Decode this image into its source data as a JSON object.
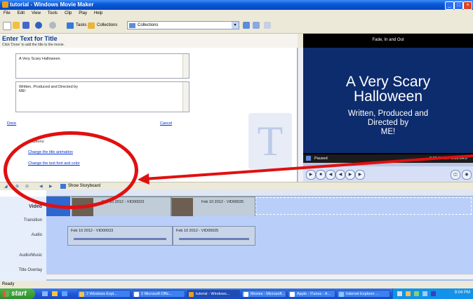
{
  "window": {
    "title": "tutorial - Windows Movie Maker",
    "controls": [
      "_",
      "□",
      "×"
    ]
  },
  "menu": [
    "File",
    "Edit",
    "View",
    "Tools",
    "Clip",
    "Play",
    "Help"
  ],
  "toolbar": {
    "tasks_label": "Tasks",
    "collections_label": "Collections",
    "collections_value": "Collections"
  },
  "title_panel": {
    "heading": "Enter Text for Title",
    "instruction": "Click 'Done' to add the title to the movie.",
    "text1": "A Very Scary Halloween",
    "text2_line1": "Written, Produced and Directed by",
    "text2_line2": "ME!",
    "done_label": "Done",
    "cancel_label": "Cancel",
    "more_options_label": "e options:",
    "option1": "Change the title animation",
    "option2": "Change the text font and color",
    "watermark": "T"
  },
  "preview": {
    "caption": "Fade, In and Out",
    "line1": "A Very Scary",
    "line2": "Halloween",
    "line3": "Written, Produced and",
    "line4": "Directed by",
    "line5": "ME!",
    "status": "Paused",
    "time": "0:00:00.00 / 0:00:04.0"
  },
  "timeline": {
    "storyboard_label": "Show Storyboard",
    "tracks": [
      "Video",
      "Transition",
      "Audio",
      "Audio/Music",
      "Title Overlay"
    ],
    "video_clips": [
      "Feb 10 2012 - VID00023",
      "Feb 10 2012 - VID00025"
    ],
    "audio_clips": [
      "Feb 10 2012 - VID00023",
      "Feb 10 2012 - VID00025"
    ]
  },
  "status": {
    "text": "Ready"
  },
  "taskbar": {
    "start": "start",
    "tasks": [
      "2 Windows Expl...",
      "2 Microsoft Offic...",
      "tutorial - Windows...",
      "Movies - Microsoft...",
      "Apple - iTunes - A...",
      "Internet Explorer ..."
    ],
    "clock": "9:04 PM"
  },
  "colors": {
    "annotation": "#e01010",
    "preview_bg": "#0d2c6e",
    "title_blue": "#0b3b8c"
  }
}
